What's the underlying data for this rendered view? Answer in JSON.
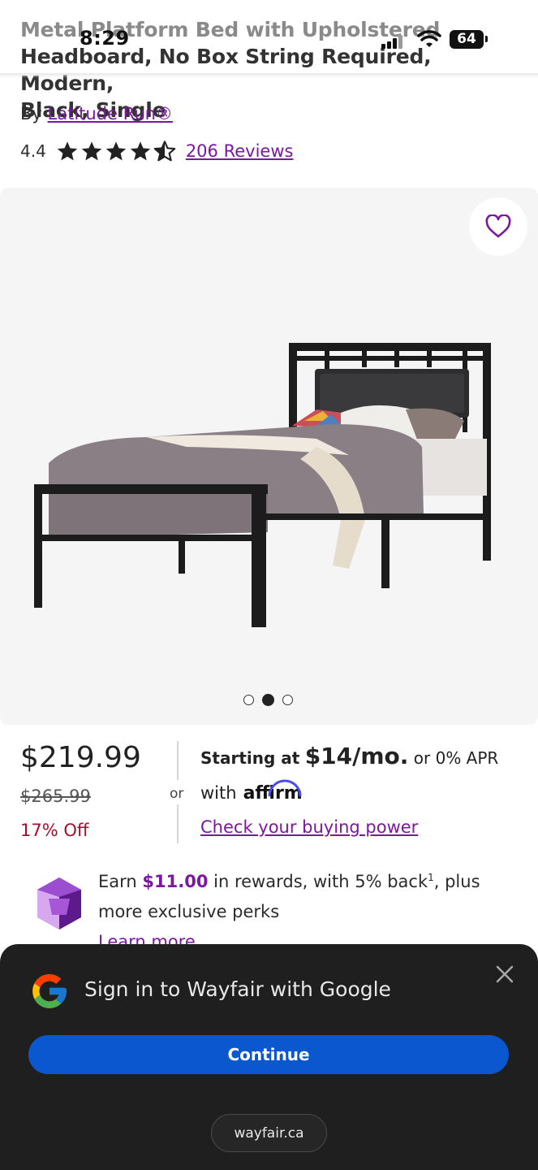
{
  "status_bar": {
    "time": "8:29",
    "battery": "64"
  },
  "product": {
    "title_line1": "Metal Platform Bed with Upholstered",
    "title_line2": "Headboard, No Box String Required, Modern,",
    "title_line3": "Black, Single",
    "by_prefix": "By",
    "brand": "Latitude Run®",
    "rating": "4.4",
    "stars_value": 4.4,
    "reviews": "206 Reviews"
  },
  "gallery": {
    "image_count": 3,
    "active_index": 1
  },
  "pricing": {
    "price": "$219.99",
    "original_price": "$265.99",
    "discount": "17% Off",
    "or": "or",
    "starting_at": "Starting at",
    "monthly": "$14/mo.",
    "apr_text": "or 0% APR",
    "with": "with",
    "affirm": "affirm",
    "check_link": "Check your buying power"
  },
  "rewards": {
    "earn": "Earn",
    "amount": "$11.00",
    "text1": "in rewards, with 5% back",
    "footnote": "1",
    "text2": ", plus more exclusive perks",
    "learn_more": "Learn more"
  },
  "google_sheet": {
    "title": "Sign in to Wayfair with Google",
    "continue_label": "Continue",
    "domain": "wayfair.ca"
  },
  "colors": {
    "accent_purple": "#7b189f",
    "discount_red": "#a50f2d",
    "google_blue": "#0b57d0",
    "sheet_bg": "#1f1f1f"
  }
}
